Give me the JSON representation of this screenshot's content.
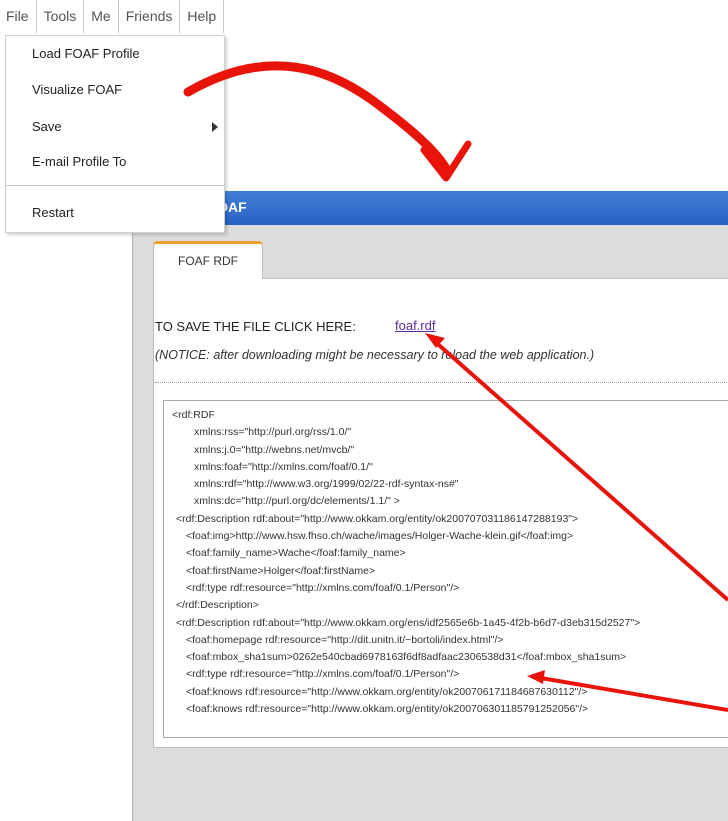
{
  "menubar": {
    "items": [
      "File",
      "Tools",
      "Me",
      "Friends",
      "Help"
    ]
  },
  "file_menu": {
    "items": [
      {
        "label": "Load FOAF Profile"
      },
      {
        "label": "Visualize FOAF"
      },
      {
        "label": "Save",
        "submenu": true
      },
      {
        "label": "E-mail Profile To"
      },
      {
        "label": "Restart"
      }
    ]
  },
  "dialog": {
    "title": "Visualize FOAF",
    "tab_label": "FOAF RDF",
    "save_label": "TO SAVE THE FILE CLICK HERE:",
    "save_link": "foaf.rdf",
    "notice": "(NOTICE: after downloading might be necessary to reload the web application.)",
    "code_lines": [
      "<rdf:RDF",
      "xmlns:rss=\"http://purl.org/rss/1.0/\"",
      "xmlns:j.0=\"http://webns.net/mvcb/\"",
      "xmlns:foaf=\"http://xmlns.com/foaf/0.1/\"",
      "xmlns:rdf=\"http://www.w3.org/1999/02/22-rdf-syntax-ns#\"",
      "xmlns:dc=\"http://purl.org/dc/elements/1.1/\" >",
      "<rdf:Description rdf:about=\"http://www.okkam.org/entity/ok200707031186147288193\">",
      "<foaf:img>http://www.hsw.fhso.ch/wache/images/Holger-Wache-klein.gif</foaf:img>",
      "<foaf:family_name>Wache</foaf:family_name>",
      "<foaf:firstName>Holger</foaf:firstName>",
      "<rdf:type rdf:resource=\"http://xmlns.com/foaf/0.1/Person\"/>",
      "</rdf:Description>",
      "<rdf:Description rdf:about=\"http://www.okkam.org/ens/idf2565e6b-1a45-4f2b-b6d7-d3eb315d2527\">",
      "<foaf:homepage rdf:resource=\"http://dit.unitn.it/~bortoli/index.html\"/>",
      "<foaf:mbox_sha1sum>0262e540cbad6978163f6df8adfaac2306538d31</foaf:mbox_sha1sum>",
      "<rdf:type rdf:resource=\"http://xmlns.com/foaf/0.1/Person\"/>",
      "<foaf:knows rdf:resource=\"http://www.okkam.org/entity/ok200706171184687630112\"/>",
      "<foaf:knows rdf:resource=\"http://www.okkam.org/entity/ok200706301185791252056\"/>"
    ]
  },
  "colors": {
    "titlebar": "#2f6bcc",
    "tab_accent": "#f0a030",
    "annotation_arrow": "#e8140a",
    "link": "#5a2ca0"
  }
}
